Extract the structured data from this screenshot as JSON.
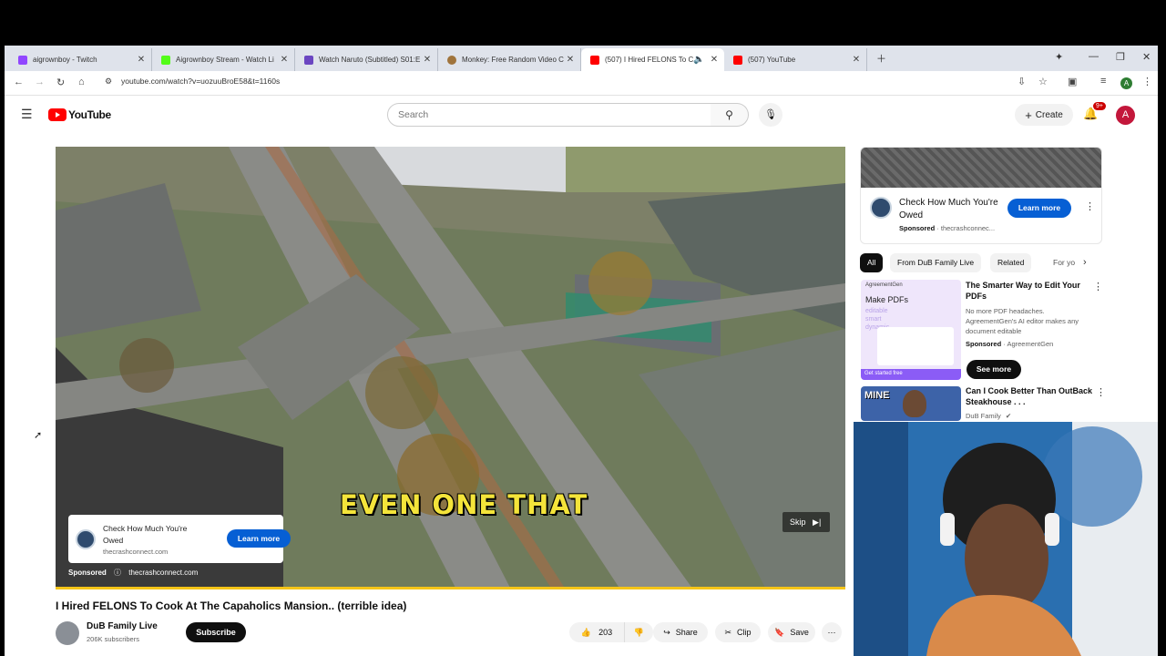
{
  "browser": {
    "tabs": [
      {
        "title": "aigrownboy - Twitch",
        "favicon_color": "#9146ff"
      },
      {
        "title": "Aigrownboy Stream - Watch Li",
        "favicon_color": "#53fc18"
      },
      {
        "title": "Watch Naruto (Subtitled) S01:E",
        "favicon_color": "#6b46c1"
      },
      {
        "title": "Monkey: Free Random Video C",
        "favicon_color": "#a0743c"
      },
      {
        "title": "(507) I Hired FELONS To Co",
        "favicon_color": "#ff0000"
      },
      {
        "title": "(507) YouTube",
        "favicon_color": "#ff0000"
      }
    ],
    "url": "youtube.com/watch?v=uozuuBroE58&t=1160s"
  },
  "youtube": {
    "logo_text": "YouTube",
    "search_placeholder": "Search",
    "create_label": "Create",
    "notifications_badge": "9+",
    "avatar_letter": "A"
  },
  "video": {
    "caption": "EVEN ONE THAT",
    "ad": {
      "title": "Check How Much You're Owed",
      "domain": "thecrashconnect.com",
      "learn_more": "Learn more",
      "sponsored": "Sponsored",
      "sponsor_domain": "thecrashconnect.com"
    },
    "skip_label": "Skip",
    "title": "I Hired FELONS To Cook At The Capaholics Mansion.. (terrible idea)",
    "channel": "DuB Family Live",
    "subscribers": "206K subscribers",
    "subscribe_label": "Subscribe",
    "likes": "203",
    "share_label": "Share",
    "clip_label": "Clip",
    "save_label": "Save"
  },
  "sidebar": {
    "ad": {
      "title": "Check How Much You're Owed",
      "sponsored": "Sponsored",
      "domain": "thecrashconnec...",
      "learn_more": "Learn more"
    },
    "chips": [
      "All",
      "From DuB Family Live",
      "Related",
      "For yo"
    ],
    "items": [
      {
        "thumb_brand": "AgreementGen",
        "thumb_text": "Make PDFs",
        "thumb_text2": "editable smart dynamic",
        "thumb_cta": "Get started free",
        "title": "The Smarter Way to Edit Your PDFs",
        "description": "No more PDF headaches. AgreementGen's AI editor makes any document editable",
        "sponsored": "Sponsored",
        "sponsor": "AgreementGen",
        "cta": "See more"
      },
      {
        "thumb_text": "MINE",
        "title": "Can I Cook Better Than OutBack Steakhouse . . .",
        "channel": "DuB Family"
      }
    ]
  }
}
